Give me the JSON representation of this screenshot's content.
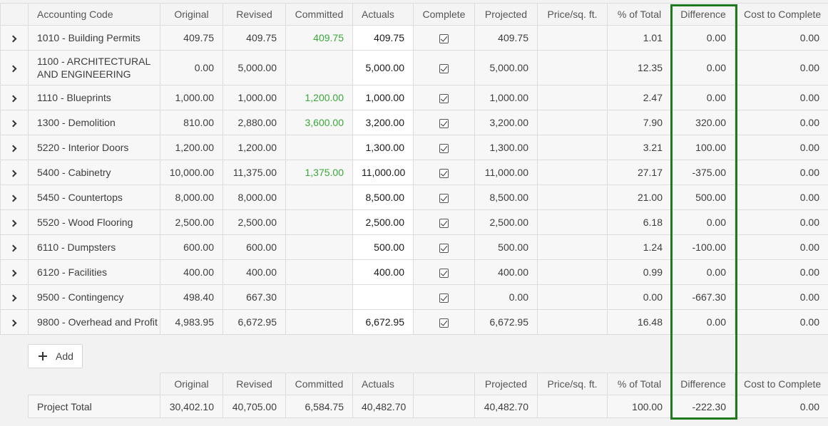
{
  "columns": {
    "accounting_code": "Accounting Code",
    "original": "Original",
    "revised": "Revised",
    "committed": "Committed",
    "actuals": "Actuals",
    "complete": "Complete",
    "projected": "Projected",
    "price_sqft": "Price/sq. ft.",
    "pct_total": "% of Total",
    "difference": "Difference",
    "cost_to_complete": "Cost to Complete"
  },
  "rows": [
    {
      "code": "1010 - Building Permits",
      "original": "409.75",
      "revised": "409.75",
      "committed": "409.75",
      "actuals": "409.75",
      "projected": "409.75",
      "price_sqft": "",
      "pct_total": "1.01",
      "difference": "0.00",
      "cost_to_complete": "0.00"
    },
    {
      "code": "1100 - ARCHITECTURAL AND ENGINEERING",
      "original": "0.00",
      "revised": "5,000.00",
      "committed": "",
      "actuals": "5,000.00",
      "projected": "5,000.00",
      "price_sqft": "",
      "pct_total": "12.35",
      "difference": "0.00",
      "cost_to_complete": "0.00"
    },
    {
      "code": "1110 - Blueprints",
      "original": "1,000.00",
      "revised": "1,000.00",
      "committed": "1,200.00",
      "actuals": "1,000.00",
      "projected": "1,000.00",
      "price_sqft": "",
      "pct_total": "2.47",
      "difference": "0.00",
      "cost_to_complete": "0.00"
    },
    {
      "code": "1300 - Demolition",
      "original": "810.00",
      "revised": "2,880.00",
      "committed": "3,600.00",
      "actuals": "3,200.00",
      "projected": "3,200.00",
      "price_sqft": "",
      "pct_total": "7.90",
      "difference": "320.00",
      "cost_to_complete": "0.00"
    },
    {
      "code": "5220 - Interior Doors",
      "original": "1,200.00",
      "revised": "1,200.00",
      "committed": "",
      "actuals": "1,300.00",
      "projected": "1,300.00",
      "price_sqft": "",
      "pct_total": "3.21",
      "difference": "100.00",
      "cost_to_complete": "0.00"
    },
    {
      "code": "5400 - Cabinetry",
      "original": "10,000.00",
      "revised": "11,375.00",
      "committed": "1,375.00",
      "actuals": "11,000.00",
      "projected": "11,000.00",
      "price_sqft": "",
      "pct_total": "27.17",
      "difference": "-375.00",
      "cost_to_complete": "0.00"
    },
    {
      "code": "5450 - Countertops",
      "original": "8,000.00",
      "revised": "8,000.00",
      "committed": "",
      "actuals": "8,500.00",
      "projected": "8,500.00",
      "price_sqft": "",
      "pct_total": "21.00",
      "difference": "500.00",
      "cost_to_complete": "0.00"
    },
    {
      "code": "5520 - Wood Flooring",
      "original": "2,500.00",
      "revised": "2,500.00",
      "committed": "",
      "actuals": "2,500.00",
      "projected": "2,500.00",
      "price_sqft": "",
      "pct_total": "6.18",
      "difference": "0.00",
      "cost_to_complete": "0.00"
    },
    {
      "code": "6110 - Dumpsters",
      "original": "600.00",
      "revised": "600.00",
      "committed": "",
      "actuals": "500.00",
      "projected": "500.00",
      "price_sqft": "",
      "pct_total": "1.24",
      "difference": "-100.00",
      "cost_to_complete": "0.00"
    },
    {
      "code": "6120 - Facilities",
      "original": "400.00",
      "revised": "400.00",
      "committed": "",
      "actuals": "400.00",
      "projected": "400.00",
      "price_sqft": "",
      "pct_total": "0.99",
      "difference": "0.00",
      "cost_to_complete": "0.00"
    },
    {
      "code": "9500 - Contingency",
      "original": "498.40",
      "revised": "667.30",
      "committed": "",
      "actuals": "",
      "projected": "0.00",
      "price_sqft": "",
      "pct_total": "0.00",
      "difference": "-667.30",
      "cost_to_complete": "0.00"
    },
    {
      "code": "9800 - Overhead and Profit",
      "original": "4,983.95",
      "revised": "6,672.95",
      "committed": "",
      "actuals": "6,672.95",
      "projected": "6,672.95",
      "price_sqft": "",
      "pct_total": "16.48",
      "difference": "0.00",
      "cost_to_complete": "0.00"
    }
  ],
  "add_button": {
    "label": "Add"
  },
  "totals": {
    "label": "Project Total",
    "original": "30,402.10",
    "revised": "40,705.00",
    "committed": "6,584.75",
    "actuals": "40,482.70",
    "projected": "40,482.70",
    "price_sqft": "",
    "pct_total": "100.00",
    "difference": "-222.30",
    "cost_to_complete": "0.00"
  },
  "colors": {
    "highlight": "#1f7a1f",
    "committed_text": "#3aa83a"
  },
  "icons": {
    "expander": "chevron-right-icon",
    "complete": "checkbox-checked-icon",
    "add": "plus-icon"
  }
}
